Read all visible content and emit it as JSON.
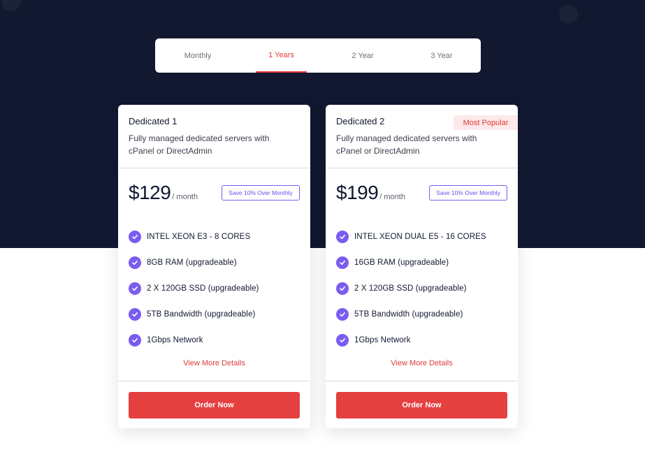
{
  "tabs": [
    {
      "label": "Monthly"
    },
    {
      "label": "1 Years",
      "active": true
    },
    {
      "label": "2 Year"
    },
    {
      "label": "3 Year"
    }
  ],
  "plans": [
    {
      "name": "Dedicated 1",
      "description": "Fully managed dedicated servers with cPanel or DirectAdmin",
      "price": "$129",
      "period": "/ month",
      "save_badge": "Save 10% Over Monthly",
      "features": [
        "INTEL XEON E3 - 8 CORES",
        "8GB RAM (upgradeable)",
        "2 X 120GB SSD (upgradeable)",
        "5TB Bandwidth (upgradeable)",
        "1Gbps Network"
      ],
      "details_link": "View More Details",
      "order_button": "Order Now"
    },
    {
      "name": "Dedicated 2",
      "badge": "Most Popular",
      "description": "Fully managed dedicated servers with cPanel or DirectAdmin",
      "price": "$199",
      "period": "/ month",
      "save_badge": "Save 10% Over Monthly",
      "features": [
        "INTEL XEON DUAL E5 - 16 CORES",
        "16GB RAM (upgradeable)",
        "2 X 120GB SSD (upgradeable)",
        "5TB Bandwidth (upgradeable)",
        "1Gbps Network"
      ],
      "details_link": "View More Details",
      "order_button": "Order Now"
    }
  ],
  "colors": {
    "dark_background": "#111830",
    "accent_red": "#e54040",
    "accent_purple": "#7b5cf0"
  },
  "icons": {
    "feature_check": "check-circle-icon"
  }
}
